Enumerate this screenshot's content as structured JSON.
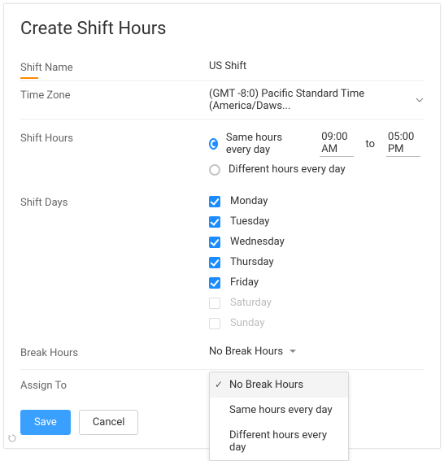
{
  "title": "Create Shift Hours",
  "fields": {
    "shift_name": {
      "label": "Shift Name",
      "value": "US Shift"
    },
    "time_zone": {
      "label": "Time Zone",
      "value": "(GMT -8:0) Pacific Standard Time (America/Daws..."
    },
    "shift_hours": {
      "label": "Shift Hours",
      "options": {
        "same": {
          "label": "Same hours every day",
          "checked": true,
          "from": "09:00 AM",
          "to_word": "to",
          "to": "05:00 PM"
        },
        "diff": {
          "label": "Different hours every day",
          "checked": false
        }
      }
    },
    "shift_days": {
      "label": "Shift Days",
      "days": [
        {
          "label": "Monday",
          "checked": true
        },
        {
          "label": "Tuesday",
          "checked": true
        },
        {
          "label": "Wednesday",
          "checked": true
        },
        {
          "label": "Thursday",
          "checked": true
        },
        {
          "label": "Friday",
          "checked": true
        },
        {
          "label": "Saturday",
          "checked": false
        },
        {
          "label": "Sunday",
          "checked": false
        }
      ]
    },
    "break_hours": {
      "label": "Break Hours",
      "value": "No Break Hours",
      "options": [
        {
          "label": "No Break Hours",
          "selected": true
        },
        {
          "label": "Same hours every day",
          "selected": false
        },
        {
          "label": "Different hours every day",
          "selected": false
        }
      ]
    },
    "assign_to": {
      "label": "Assign To"
    }
  },
  "buttons": {
    "save": "Save",
    "cancel": "Cancel"
  }
}
